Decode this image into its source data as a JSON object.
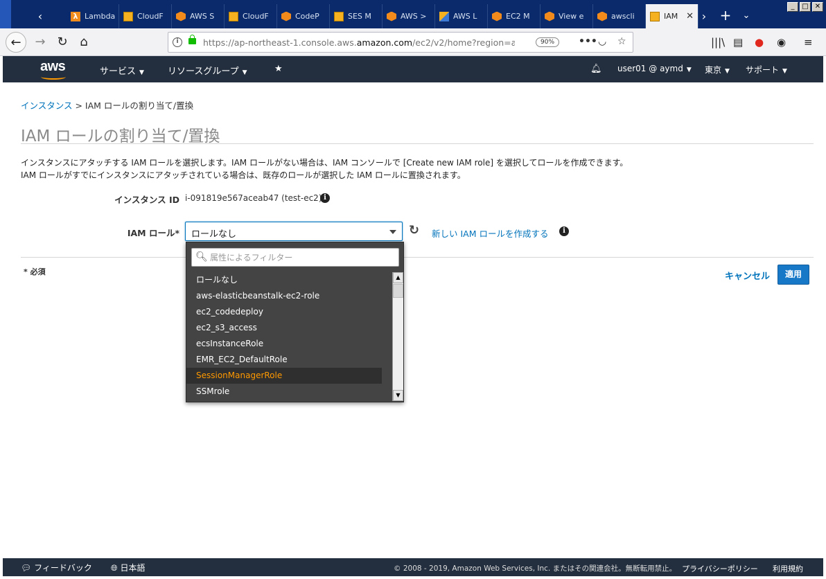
{
  "browser": {
    "tabs": [
      {
        "label": "Lambda",
        "icon": "lambda-icon"
      },
      {
        "label": "CloudF",
        "icon": "box-icon"
      },
      {
        "label": "AWS S",
        "icon": "aws-cube-icon"
      },
      {
        "label": "CloudF",
        "icon": "box-icon"
      },
      {
        "label": "CodeP",
        "icon": "aws-cube-icon"
      },
      {
        "label": "SES M",
        "icon": "box-icon"
      },
      {
        "label": "AWS >",
        "icon": "aws-cube-icon"
      },
      {
        "label": "AWS L",
        "icon": "mixed-icon"
      },
      {
        "label": "EC2 M",
        "icon": "aws-cube-icon"
      },
      {
        "label": "View e",
        "icon": "aws-cube-icon"
      },
      {
        "label": "awscli",
        "icon": "aws-cube-icon"
      },
      {
        "label": "IAM",
        "icon": "box-icon"
      }
    ],
    "url_prefix": "https://ap-northeast-1.console.aws.",
    "url_domain": "amazon.com",
    "url_suffix": "/ec2/v2/home?region=ap-n",
    "zoom": "90%"
  },
  "aws_header": {
    "logo": "aws",
    "services": "サービス",
    "resource_groups": "リソースグループ",
    "user": "user01 @ aymd",
    "region": "東京",
    "support": "サポート"
  },
  "page": {
    "breadcrumb_link": "インスタンス",
    "breadcrumb_rest": " > IAM ロールの割り当て/置換",
    "title": "IAM ロールの割り当て/置換",
    "desc_line1": "インスタンスにアタッチする IAM ロールを選択します。IAM ロールがない場合は、IAM コンソールで [Create new IAM role] を選択してロールを作成できます。",
    "desc_line2": "IAM ロールがすでにインスタンスにアタッチされている場合は、既存のロールが選択した IAM ロールに置換されます。",
    "instance_id_label": "インスタンス ID",
    "instance_id_value": "i-091819e567aceab47 (test-ec2)",
    "iam_role_label": "IAM ロール*",
    "iam_role_selected": "ロールなし",
    "create_role_link": "新しい IAM ロールを作成する",
    "required_note": "* 必須",
    "cancel": "キャンセル",
    "apply": "適用"
  },
  "dropdown": {
    "filter_placeholder": "属性によるフィルター",
    "options": [
      "ロールなし",
      "aws-elasticbeanstalk-ec2-role",
      "ec2_codedeploy",
      "ec2_s3_access",
      "ecsInstanceRole",
      "EMR_EC2_DefaultRole",
      "SessionManagerRole",
      "SSMrole"
    ],
    "highlighted": "SessionManagerRole"
  },
  "footer": {
    "feedback": "フィードバック",
    "language": "日本語",
    "copyright": "© 2008 - 2019, Amazon Web Services, Inc. またはその関連会社。無断転用禁止。",
    "privacy": "プライバシーポリシー",
    "terms": "利用規約"
  },
  "colors": {
    "aws_header_bg": "#232f3e",
    "link": "#0073bb",
    "highlight": "#ff9900",
    "primary_button": "#1878c8"
  }
}
